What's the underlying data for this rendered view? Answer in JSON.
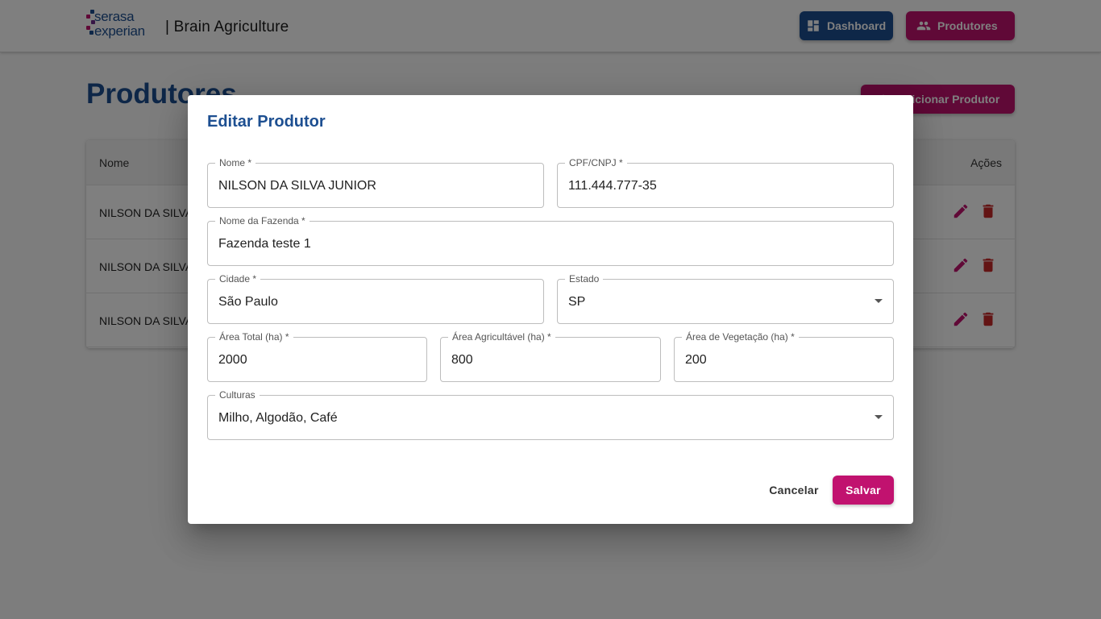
{
  "header": {
    "logo_line1": "serasa",
    "logo_line2": "experian",
    "app_title": "| Brain Agriculture",
    "nav": [
      {
        "label": "Dashboard",
        "icon": "dashboard-icon"
      },
      {
        "label": "Produtores",
        "icon": "people-icon"
      }
    ]
  },
  "page": {
    "title": "Produtores",
    "add_button_label": "Adicionar Produtor"
  },
  "table": {
    "columns": {
      "nome": "Nome",
      "acoes": "Ações"
    },
    "rows": [
      {
        "nome": "NILSON DA SILVA JUNIOR"
      },
      {
        "nome": "NILSON DA SILVA JUNIOR"
      },
      {
        "nome": "NILSON DA SILVA JUNIOR"
      }
    ]
  },
  "dialog": {
    "title": "Editar Produtor",
    "fields": {
      "nome": {
        "label": "Nome *",
        "value": "NILSON DA SILVA JUNIOR"
      },
      "cpf": {
        "label": "CPF/CNPJ *",
        "value": "111.444.777-35"
      },
      "fazenda": {
        "label": "Nome da Fazenda *",
        "value": "Fazenda teste 1"
      },
      "cidade": {
        "label": "Cidade *",
        "value": "São Paulo"
      },
      "estado": {
        "label": "Estado",
        "value": "SP"
      },
      "area_total": {
        "label": "Área Total (ha) *",
        "value": "2000"
      },
      "area_agri": {
        "label": "Área Agricultável (ha) *",
        "value": "800"
      },
      "area_veg": {
        "label": "Área de Vegetação (ha) *",
        "value": "200"
      },
      "culturas": {
        "label": "Culturas",
        "value": "Milho, Algodão, Café"
      }
    },
    "cancel_label": "Cancelar",
    "save_label": "Salvar"
  },
  "colors": {
    "primary_blue": "#1d4f91",
    "accent_magenta": "#c1126f",
    "delete_red": "#c62828"
  }
}
